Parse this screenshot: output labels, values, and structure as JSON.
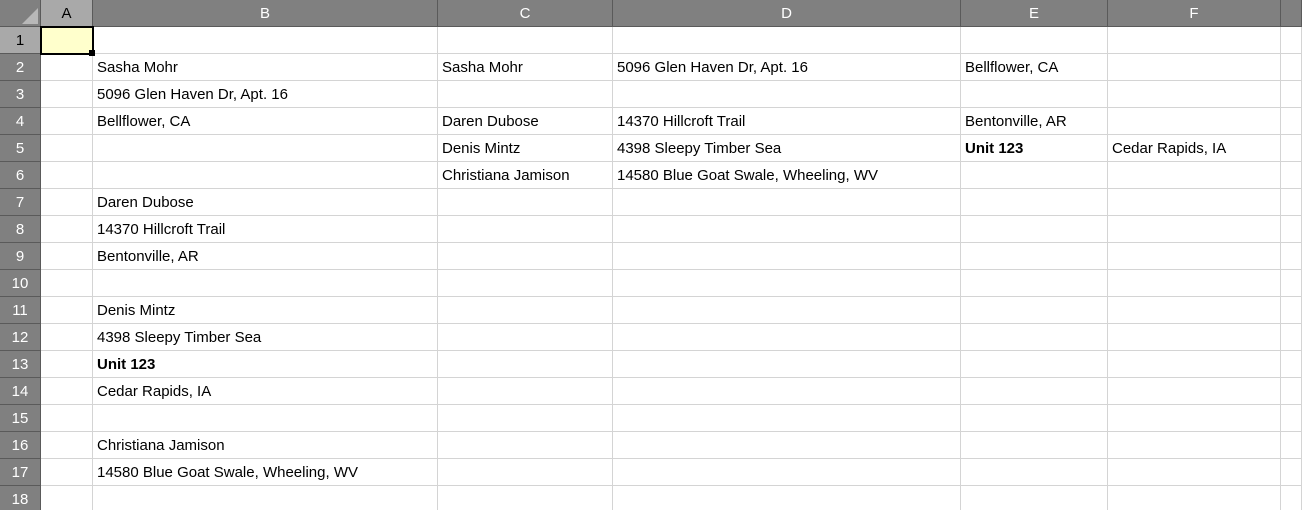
{
  "columns": [
    "A",
    "B",
    "C",
    "D",
    "E",
    "F",
    ""
  ],
  "rowCount": 18,
  "activeCell": {
    "row": 1,
    "col": "A"
  },
  "cells": {
    "B2": {
      "v": "Sasha Mohr"
    },
    "C2": {
      "v": "Sasha Mohr"
    },
    "D2": {
      "v": "5096 Glen Haven Dr,  Apt. 16"
    },
    "E2": {
      "v": "Bellflower, CA"
    },
    "B3": {
      "v": "5096 Glen Haven Dr,  Apt. 16"
    },
    "B4": {
      "v": "Bellflower, CA"
    },
    "C4": {
      "v": "Daren Dubose"
    },
    "D4": {
      "v": "14370 Hillcroft Trail"
    },
    "E4": {
      "v": "Bentonville, AR"
    },
    "C5": {
      "v": "Denis Mintz"
    },
    "D5": {
      "v": "4398 Sleepy Timber Sea"
    },
    "E5": {
      "v": "Unit 123",
      "bold": true
    },
    "F5": {
      "v": "Cedar Rapids, IA"
    },
    "C6": {
      "v": "Christiana Jamison"
    },
    "D6": {
      "v": "14580 Blue Goat Swale, Wheeling, WV"
    },
    "B7": {
      "v": "Daren Dubose"
    },
    "B8": {
      "v": "14370 Hillcroft Trail"
    },
    "B9": {
      "v": "Bentonville, AR"
    },
    "B11": {
      "v": "Denis Mintz"
    },
    "B12": {
      "v": "4398 Sleepy Timber Sea"
    },
    "B13": {
      "v": "Unit 123",
      "bold": true
    },
    "B14": {
      "v": "Cedar Rapids, IA"
    },
    "B16": {
      "v": "Christiana Jamison"
    },
    "B17": {
      "v": "14580 Blue Goat Swale, Wheeling, WV"
    }
  }
}
